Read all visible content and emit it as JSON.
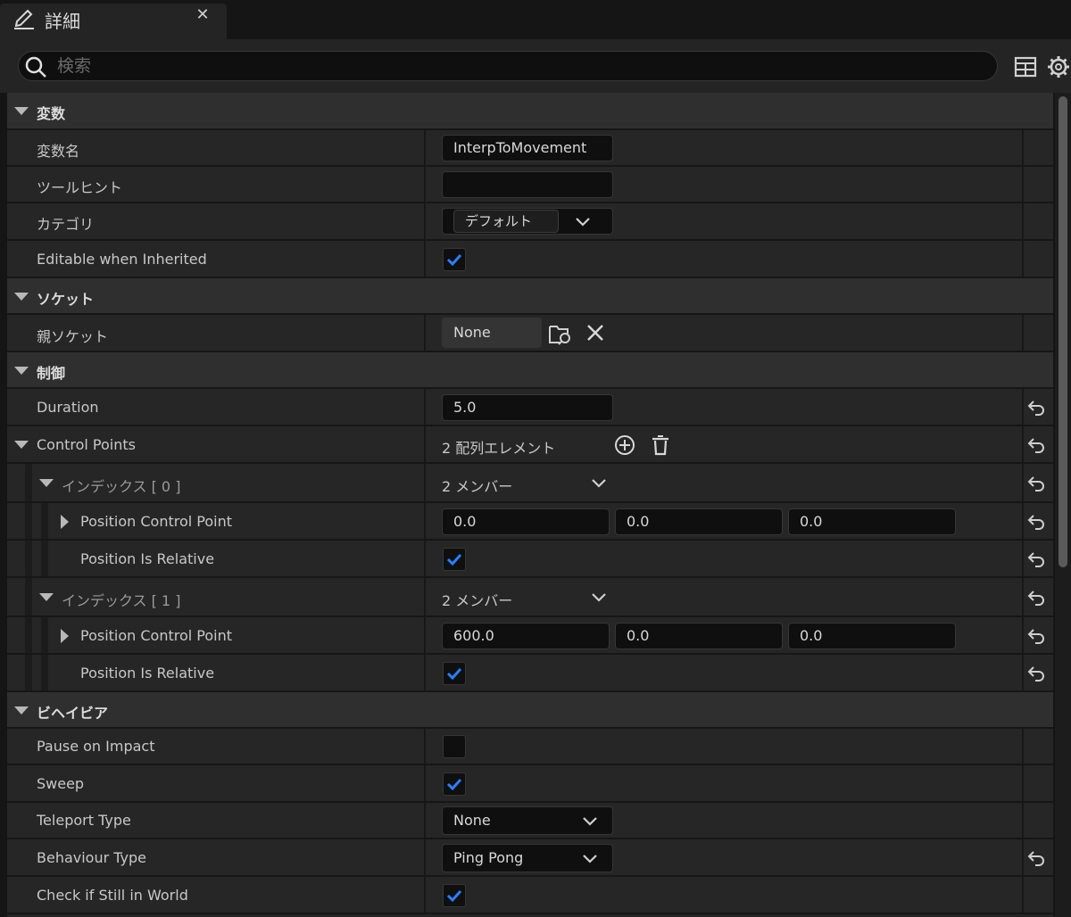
{
  "tab": {
    "title": "詳細",
    "close": "✕"
  },
  "search": {
    "placeholder": "検索"
  },
  "categories": {
    "variables": "変数",
    "socket": "ソケット",
    "control": "制御",
    "behavior": "ビヘイビア"
  },
  "variables": {
    "name_label": "変数名",
    "name_value": "InterpToMovement",
    "tooltip_label": "ツールヒント",
    "tooltip_value": "",
    "category_label": "カテゴリ",
    "category_value": "デフォルト",
    "editable_label": "Editable when Inherited",
    "editable_checked": true
  },
  "socket": {
    "parent_label": "親ソケット",
    "parent_value": "None"
  },
  "control": {
    "duration_label": "Duration",
    "duration_value": "5.0",
    "control_points_label": "Control Points",
    "control_points_value": "2 配列エレメント",
    "index0_label": "インデックス [ 0 ]",
    "index0_value": "2 メンバー",
    "index0_pos_label": "Position Control Point",
    "index0_pos": [
      "0.0",
      "0.0",
      "0.0"
    ],
    "index0_rel_label": "Position Is Relative",
    "index0_rel_checked": true,
    "index1_label": "インデックス [ 1 ]",
    "index1_value": "2 メンバー",
    "index1_pos_label": "Position Control Point",
    "index1_pos": [
      "600.0",
      "0.0",
      "0.0"
    ],
    "index1_rel_label": "Position Is Relative",
    "index1_rel_checked": true
  },
  "behavior": {
    "pause_label": "Pause on Impact",
    "pause_checked": false,
    "sweep_label": "Sweep",
    "sweep_checked": true,
    "teleport_label": "Teleport Type",
    "teleport_value": "None",
    "behaviour_label": "Behaviour Type",
    "behaviour_value": "Ping Pong",
    "still_label": "Check if Still in World",
    "still_checked": true
  },
  "colors": {
    "accent": "#2a7fff",
    "panel": "#242424",
    "category": "#2f2f2f"
  }
}
